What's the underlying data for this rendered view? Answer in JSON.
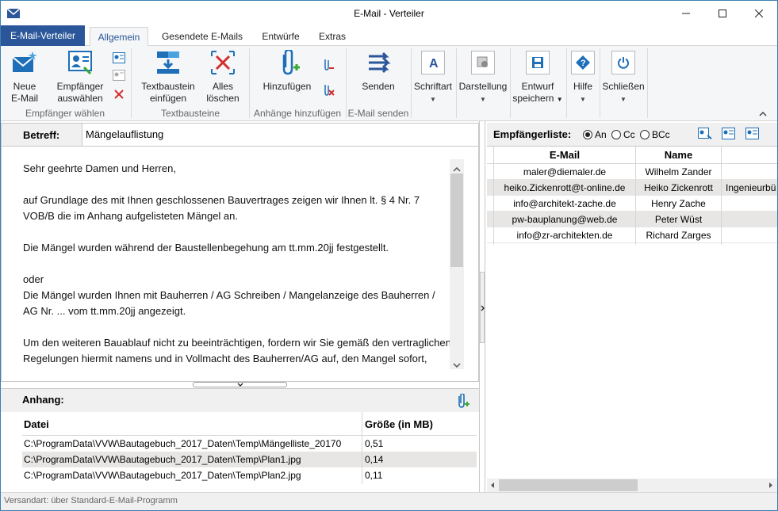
{
  "window": {
    "title": "E-Mail - Verteiler"
  },
  "tabs": {
    "file": "E-Mail-Verteiler",
    "items": [
      "Allgemein",
      "Gesendete E-Mails",
      "Entwürfe",
      "Extras"
    ]
  },
  "ribbon": {
    "new_email": [
      "Neue",
      "E-Mail"
    ],
    "select_recipients": [
      "Empfänger",
      "auswählen"
    ],
    "insert_textblock": [
      "Textbaustein",
      "einfügen"
    ],
    "clear_all": [
      "Alles",
      "löschen"
    ],
    "add": "Hinzufügen",
    "send": "Senden",
    "font": "Schriftart",
    "display": "Darstellung",
    "save_draft": [
      "Entwurf",
      "speichern"
    ],
    "help": "Hilfe",
    "close": "Schließen",
    "groups": {
      "recipients": "Empfänger wählen",
      "textblocks": "Textbausteine",
      "attachments": "Anhänge hinzufügen",
      "send": "E-Mail senden"
    }
  },
  "subject": {
    "label": "Betreff:",
    "value": "Mängelauflistung"
  },
  "body": [
    "Sehr geehrte Damen und Herren,",
    "",
    "auf Grundlage des mit Ihnen geschlossenen Bauvertrages zeigen wir Ihnen lt. § 4 Nr. 7 VOB/B die im Anhang aufgelisteten Mängel an.",
    "",
    "Die Mängel wurden während der Baustellenbegehung am tt.mm.20jj festgestellt.",
    "",
    "oder",
    "Die Mängel wurden Ihnen mit Bauherren / AG Schreiben / Mangelanzeige des Bauherren / AG Nr. ... vom tt.mm.20jj angezeigt.",
    "",
    "Um den weiteren Bauablauf nicht zu beeinträchtigen, fordern wir Sie gemäß den vertraglichen Regelungen hiermit namens und in Vollmacht des Bauherren/AG auf, den Mangel sofort,"
  ],
  "attachments": {
    "label": "Anhang:",
    "col_file": "Datei",
    "col_size": "Größe (in MB)",
    "rows": [
      {
        "file": "C:\\ProgramData\\VVW\\Bautagebuch_2017_Daten\\Temp\\Mängelliste_20170",
        "size": "0,51"
      },
      {
        "file": "C:\\ProgramData\\VVW\\Bautagebuch_2017_Daten\\Temp\\Plan1.jpg",
        "size": "0,14"
      },
      {
        "file": "C:\\ProgramData\\VVW\\Bautagebuch_2017_Daten\\Temp\\Plan2.jpg",
        "size": "0,11"
      }
    ]
  },
  "recipients": {
    "label": "Empfängerliste:",
    "radio": [
      "An",
      "Cc",
      "BCc"
    ],
    "col_email": "E-Mail",
    "col_name": "Name",
    "rows": [
      {
        "email": "maler@diemaler.de",
        "name": "Wilhelm Zander",
        "extra": ""
      },
      {
        "email": "heiko.Zickenrott@t-online.de",
        "name": "Heiko Zickenrott",
        "extra": "Ingenieurbü"
      },
      {
        "email": "info@architekt-zache.de",
        "name": "Henry Zache",
        "extra": ""
      },
      {
        "email": "pw-bauplanung@web.de",
        "name": "Peter Wüst",
        "extra": ""
      },
      {
        "email": "info@zr-architekten.de",
        "name": "Richard Zarges",
        "extra": ""
      }
    ]
  },
  "status": "Versandart: über Standard-E-Mail-Programm",
  "colors": {
    "accent": "#2b579a",
    "ribbon_bg": "#f5f6f7",
    "icon_blue": "#1e6fb8",
    "icon_red": "#d32f2f",
    "icon_green": "#3aa935"
  }
}
